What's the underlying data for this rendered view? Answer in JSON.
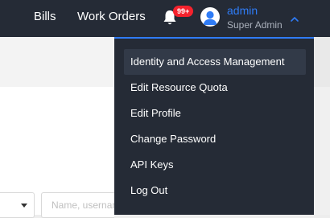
{
  "topbar": {
    "nav": [
      {
        "label": "Bills"
      },
      {
        "label": "Work Orders"
      }
    ],
    "notifications": {
      "icon": "bell-icon",
      "badge": "99+"
    },
    "user": {
      "avatar_icon": "user-avatar-icon",
      "name": "admin",
      "role": "Super Admin",
      "toggle_icon": "chevron-up-icon"
    }
  },
  "background": {
    "search": {
      "placeholder": "Name, username"
    }
  },
  "user_menu": {
    "items": [
      {
        "label": "Identity and Access Management",
        "active": true
      },
      {
        "label": "Edit Resource Quota"
      },
      {
        "label": "Edit Profile"
      },
      {
        "label": "Change Password"
      },
      {
        "label": "API Keys"
      },
      {
        "label": "Log Out"
      }
    ]
  },
  "colors": {
    "topbar_bg": "#252b36",
    "accent": "#2f7cf6",
    "badge_bg": "#f5222d",
    "menu_active_bg": "#323a48"
  }
}
